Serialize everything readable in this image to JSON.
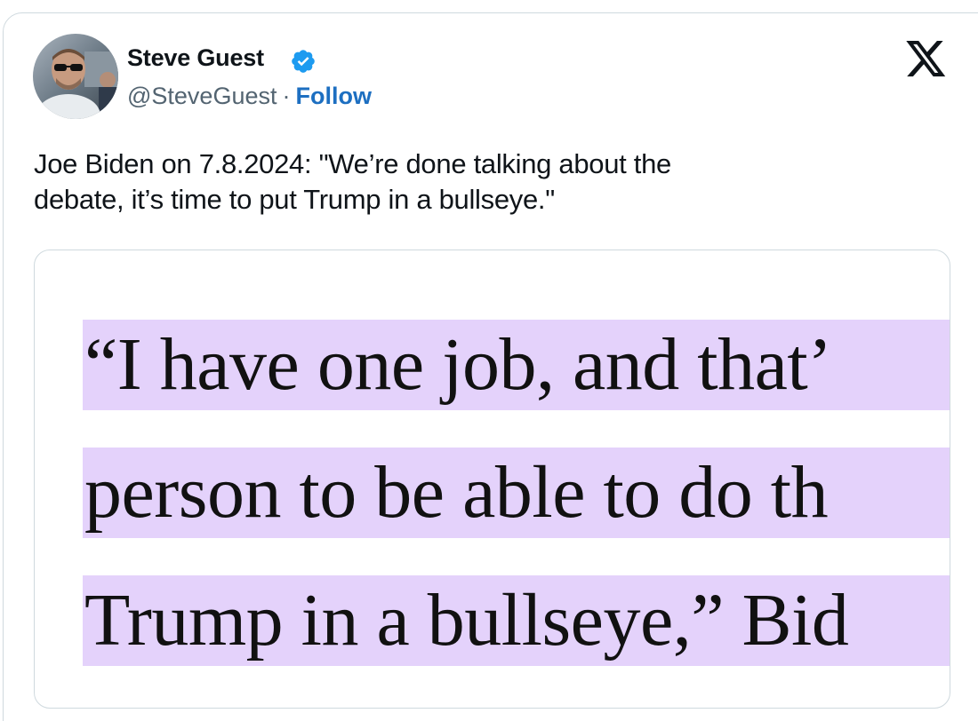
{
  "tweet": {
    "author": {
      "name": "Steve Guest",
      "handle": "@SteveGuest",
      "separator": "·",
      "follow_label": "Follow",
      "verified_icon": "verified-badge-icon",
      "verified_color": "#1d9bf0"
    },
    "platform_icon": "x-logo-icon",
    "text_line1": "Joe Biden on 7.8.2024: \"We’re done talking about the",
    "text_line2": "debate, it’s time to put Trump in a bullseye.\"",
    "media": {
      "highlight_color": "#e4d2fb",
      "lines": [
        "“I have one job, and that’",
        "person to be able to do th",
        "Trump in a bullseye,” Bid"
      ]
    }
  }
}
